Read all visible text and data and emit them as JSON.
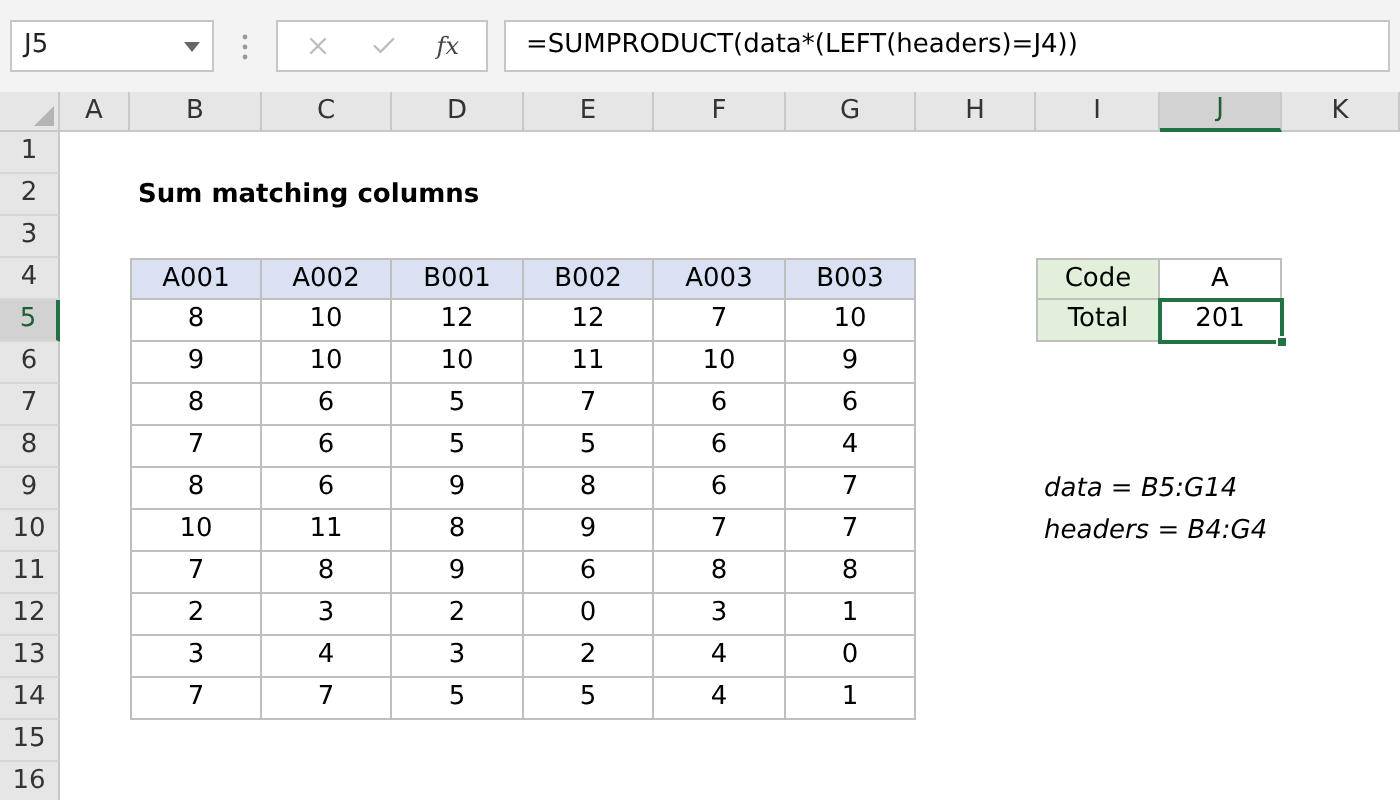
{
  "name_box": "J5",
  "function_label": "fx",
  "formula": "=SUMPRODUCT(data*(LEFT(headers)=J4))",
  "column_headers": [
    {
      "label": "A",
      "selected": false
    },
    {
      "label": "B",
      "selected": false
    },
    {
      "label": "C",
      "selected": false
    },
    {
      "label": "D",
      "selected": false
    },
    {
      "label": "E",
      "selected": false
    },
    {
      "label": "F",
      "selected": false
    },
    {
      "label": "G",
      "selected": false
    },
    {
      "label": "H",
      "selected": false
    },
    {
      "label": "I",
      "selected": false
    },
    {
      "label": "J",
      "selected": true
    },
    {
      "label": "K",
      "selected": false
    }
  ],
  "row_headers": [
    {
      "label": "1",
      "selected": false
    },
    {
      "label": "2",
      "selected": false
    },
    {
      "label": "3",
      "selected": false
    },
    {
      "label": "4",
      "selected": false
    },
    {
      "label": "5",
      "selected": true
    },
    {
      "label": "6",
      "selected": false
    },
    {
      "label": "7",
      "selected": false
    },
    {
      "label": "8",
      "selected": false
    },
    {
      "label": "9",
      "selected": false
    },
    {
      "label": "10",
      "selected": false
    },
    {
      "label": "11",
      "selected": false
    },
    {
      "label": "12",
      "selected": false
    },
    {
      "label": "13",
      "selected": false
    },
    {
      "label": "14",
      "selected": false
    },
    {
      "label": "15",
      "selected": false
    },
    {
      "label": "16",
      "selected": false
    }
  ],
  "title": "Sum matching columns",
  "table": {
    "columns": [
      "A001",
      "A002",
      "B001",
      "B002",
      "A003",
      "B003"
    ],
    "rows": [
      [
        "8",
        "10",
        "12",
        "12",
        "7",
        "10"
      ],
      [
        "9",
        "10",
        "10",
        "11",
        "10",
        "9"
      ],
      [
        "8",
        "6",
        "5",
        "7",
        "6",
        "6"
      ],
      [
        "7",
        "6",
        "5",
        "5",
        "6",
        "4"
      ],
      [
        "8",
        "6",
        "9",
        "8",
        "6",
        "7"
      ],
      [
        "10",
        "11",
        "8",
        "9",
        "7",
        "7"
      ],
      [
        "7",
        "8",
        "9",
        "6",
        "8",
        "8"
      ],
      [
        "2",
        "3",
        "2",
        "0",
        "3",
        "1"
      ],
      [
        "3",
        "4",
        "3",
        "2",
        "4",
        "0"
      ],
      [
        "7",
        "7",
        "5",
        "5",
        "4",
        "1"
      ]
    ]
  },
  "lookup": [
    {
      "label": "Code",
      "value": "A",
      "selected": false
    },
    {
      "label": "Total",
      "value": "201",
      "selected": true
    }
  ],
  "notes": [
    "data = B5:G14",
    "headers = B4:G4"
  ]
}
